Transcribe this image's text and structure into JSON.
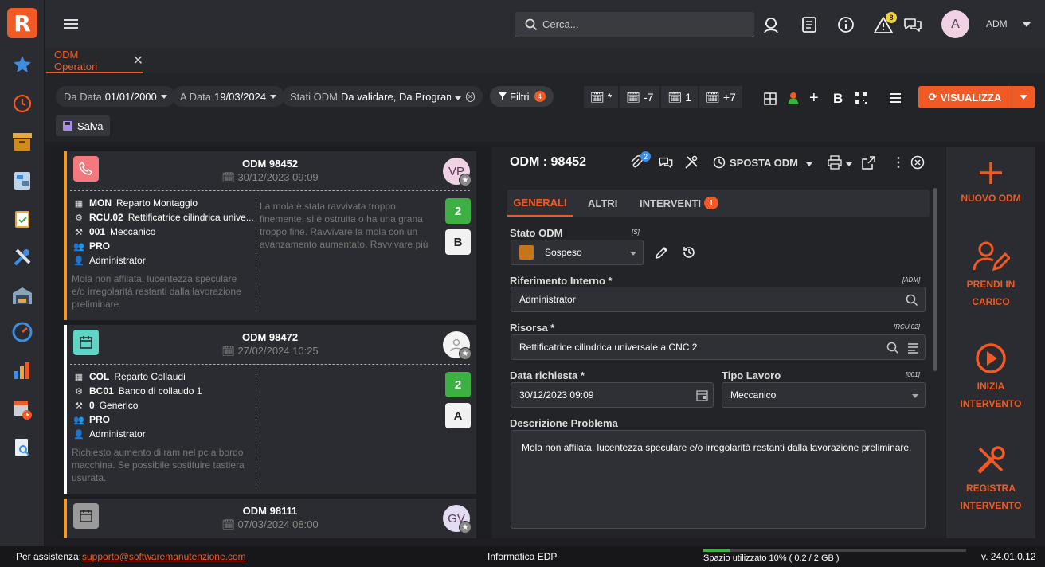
{
  "app": {
    "logo_letter": "R"
  },
  "sidebar": {
    "icons": [
      "star-icon",
      "clock-icon",
      "archive-icon",
      "plan-icon",
      "clipboard-icon",
      "tools-icon",
      "warehouse-icon",
      "gauge-icon",
      "bar-chart-icon",
      "calendar-clock-icon",
      "document-search-icon"
    ]
  },
  "header": {
    "search_placeholder": "Cerca...",
    "alert_count": "8",
    "avatar_letter": "A",
    "user": "ADM"
  },
  "tab": {
    "label": "ODM Operatori"
  },
  "filters": {
    "da_data_label": "Da Data",
    "da_data_value": "01/01/2000",
    "a_data_label": "A Data",
    "a_data_value": "19/03/2024",
    "stati_label": "Stati ODM",
    "stati_value": "Da validare, Da Programm...",
    "filtri_label": "Filtri",
    "filtri_count": "4",
    "cal_buttons": [
      "*",
      "-7",
      "1",
      "+7"
    ],
    "bold_label": "B",
    "visualizza": "VISUALIZZA",
    "salva": "Salva"
  },
  "cards": [
    {
      "odm": "ODM 98452",
      "date": "30/12/2023 09:09",
      "initials": "VP",
      "stripe": "#f59a23",
      "icon_bg": "#f4787e",
      "rows": [
        {
          "code": "MON",
          "text": "Reparto Montaggio"
        },
        {
          "code": "RCU.02",
          "text": "Rettificatrice cilindrica unive..."
        },
        {
          "code": "001",
          "text": "Meccanico"
        },
        {
          "code": "PRO",
          "text": ""
        },
        {
          "code": "",
          "text": "Administrator"
        }
      ],
      "desc": "Mola non affilata, lucentezza speculare e/o irregolarità restanti dalla lavorazione preliminare.",
      "note": "La mola è stata ravvivata troppo finemente, si è ostruita o ha una grana troppo fine. Ravvivare la mola con un avanzamento aumentato. Ravvivare più",
      "prio": "2",
      "class": "B"
    },
    {
      "odm": "ODM 98472",
      "date": "27/02/2024 10:25",
      "initials": "",
      "stripe": "#ffffff",
      "icon_bg": "#5fd6c5",
      "rows": [
        {
          "code": "COL",
          "text": "Reparto Collaudi"
        },
        {
          "code": "BC01",
          "text": "Banco di collaudo 1"
        },
        {
          "code": "0",
          "text": "Generico"
        },
        {
          "code": "PRO",
          "text": ""
        },
        {
          "code": "",
          "text": "Administrator"
        }
      ],
      "desc": "Richiesto aumento di ram nel pc a bordo macchina. Se possibile sostituire tastiera usurata.",
      "note": "",
      "prio": "2",
      "class": "A"
    },
    {
      "odm": "ODM 98111",
      "date": "07/03/2024 08:00",
      "initials": "GV",
      "stripe": "#f59a23",
      "icon_bg": "#9a9a9a"
    }
  ],
  "detail": {
    "title": "ODM : 98452",
    "attach_count": "2",
    "sposta": "SPOSTA ODM",
    "tabs": [
      "GENERALI",
      "ALTRI",
      "INTERVENTI"
    ],
    "interventi_count": "1",
    "stato_label": "Stato ODM",
    "stato_tag": "[S]",
    "stato_value": "Sospeso",
    "stato_color": "#c8741b",
    "rif_label": "Riferimento Interno *",
    "rif_tag": "[ADM]",
    "rif_value": "Administrator",
    "risorsa_label": "Risorsa *",
    "risorsa_tag": "[RCU.02]",
    "risorsa_value": "Rettificatrice cilindrica universale a CNC 2",
    "data_label": "Data richiesta *",
    "data_value": "30/12/2023 09:09",
    "tipo_label": "Tipo Lavoro",
    "tipo_tag": "[001]",
    "tipo_value": "Meccanico",
    "descr_label": "Descrizione Problema",
    "descr_value": "Mola non affilata, lucentezza speculare e/o irregolarità restanti dalla lavorazione preliminare."
  },
  "actions": [
    {
      "l1": "NUOVO ODM",
      "l2": ""
    },
    {
      "l1": "PRENDI IN",
      "l2": "CARICO"
    },
    {
      "l1": "INIZIA",
      "l2": "INTERVENTO"
    },
    {
      "l1": "REGISTRA",
      "l2": "INTERVENTO"
    }
  ],
  "footer": {
    "assist_label": "Per assistenza:",
    "email": "supporto@softwaremanutenzione.com",
    "company": "Informatica EDP",
    "space": "Spazio utilizzato 10% ( 0.2 / 2 GB )",
    "space_pct": 10,
    "version": "v. 24.01.0.12"
  }
}
